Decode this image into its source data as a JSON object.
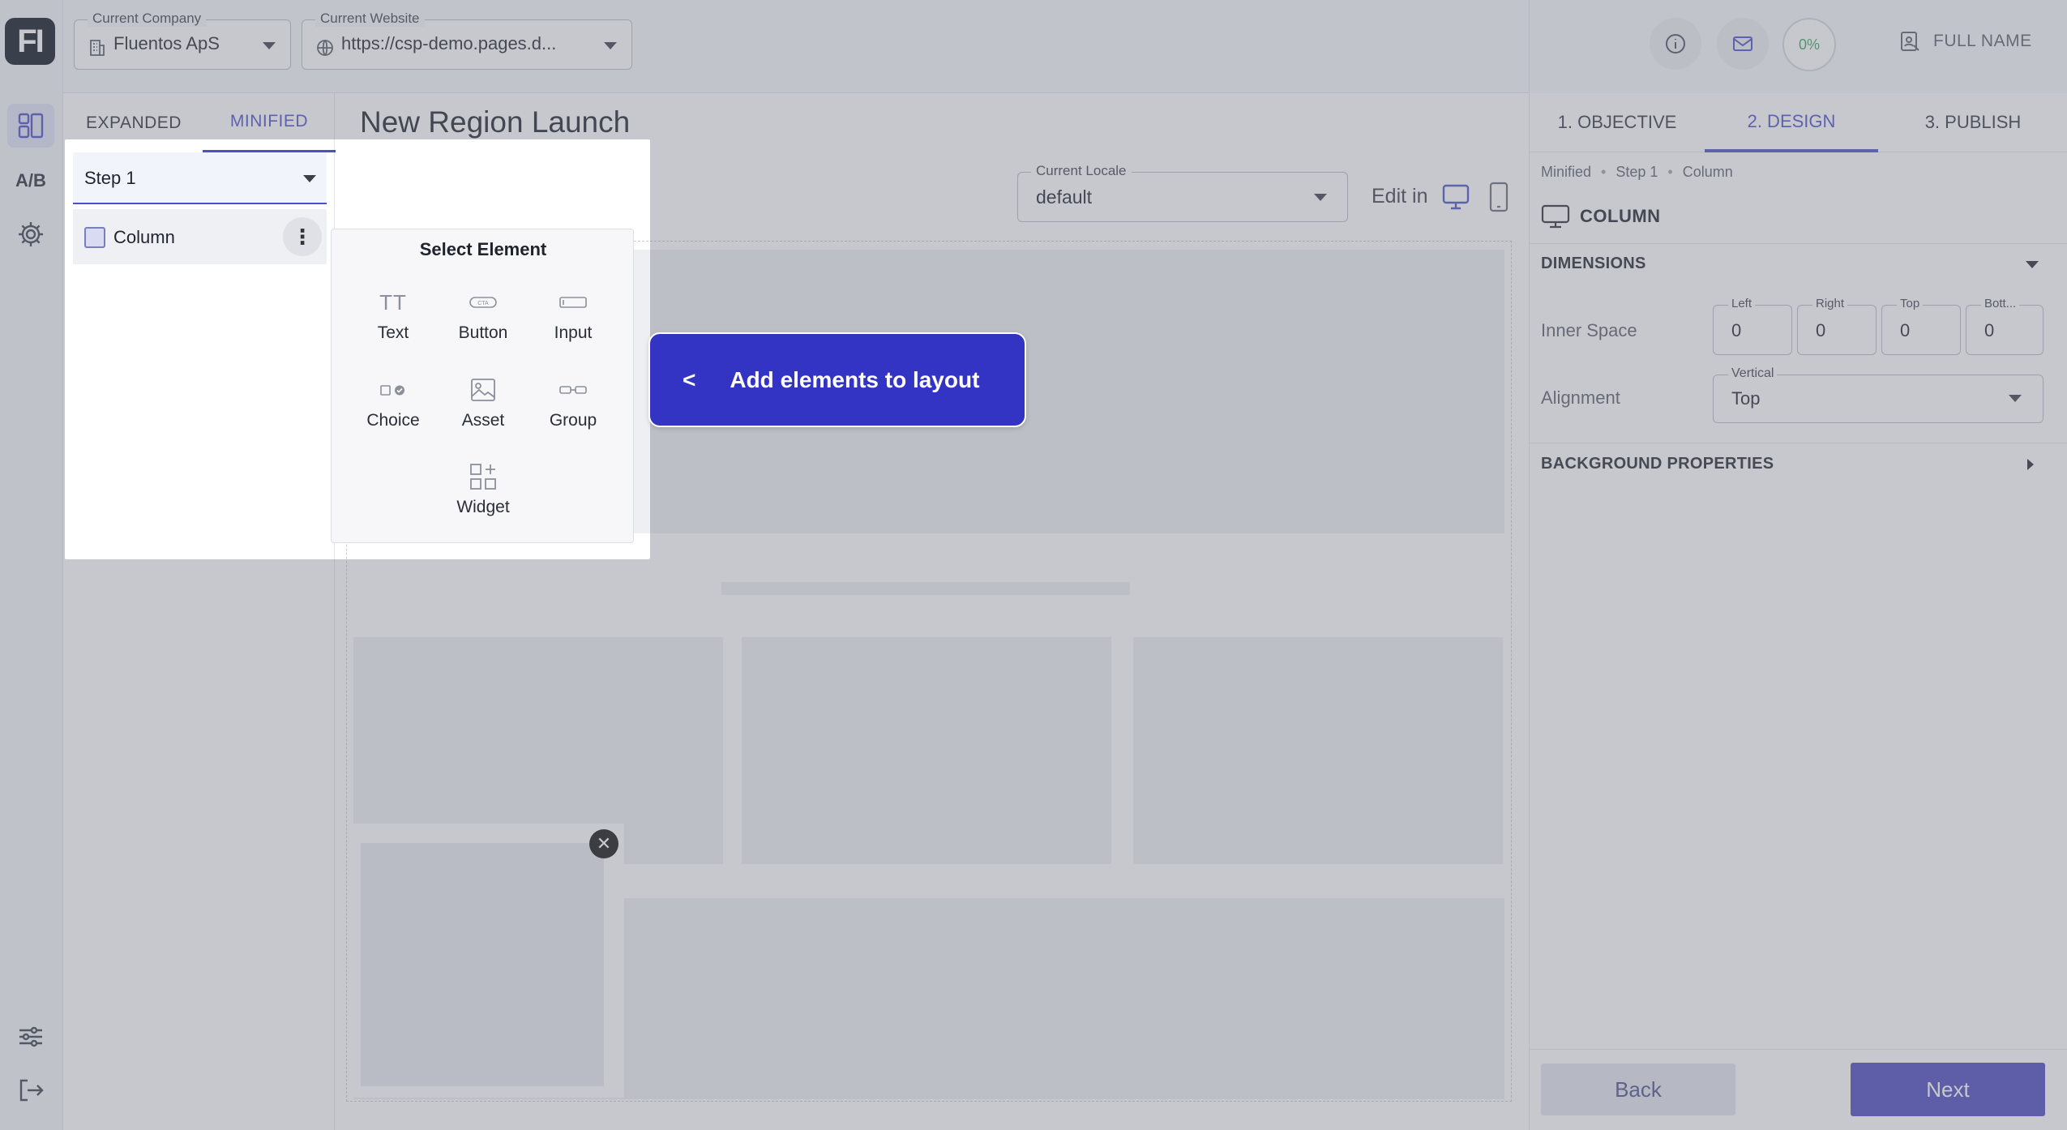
{
  "app": {
    "logo_text": "FI"
  },
  "rail": {
    "items": [
      {
        "icon": "layout-grid-icon",
        "active": true
      },
      {
        "label": "A/B",
        "icon": "ab-test-icon"
      },
      {
        "icon": "gear-icon"
      }
    ],
    "bottom_items": [
      {
        "icon": "sliders-icon"
      },
      {
        "icon": "logout-icon"
      }
    ]
  },
  "header": {
    "company": {
      "label": "Current Company",
      "value": "Fluentos ApS",
      "icon": "building-icon"
    },
    "website": {
      "label": "Current Website",
      "value": "https://csp-demo.pages.d...",
      "icon": "globe-icon"
    },
    "progress": "0%",
    "user_name": "FULL NAME",
    "icons": [
      "info-icon",
      "mail-icon",
      "user-badge-icon"
    ]
  },
  "layers_panel": {
    "tabs": [
      {
        "label": "EXPANDED",
        "active": false
      },
      {
        "label": "MINIFIED",
        "active": true
      }
    ],
    "step_select": "Step 1",
    "tree": [
      {
        "label": "Column"
      }
    ]
  },
  "main": {
    "title": "New Region Launch",
    "locale": {
      "label": "Current Locale",
      "value": "default"
    },
    "edit_in_label": "Edit in",
    "device_icons": [
      "desktop-icon",
      "mobile-icon"
    ]
  },
  "select_element": {
    "title": "Select Element",
    "options": [
      {
        "label": "Text",
        "icon": "text-icon"
      },
      {
        "label": "Button",
        "icon": "button-cta-icon",
        "icon_text": "CTA"
      },
      {
        "label": "Input",
        "icon": "input-icon"
      },
      {
        "label": "Choice",
        "icon": "choice-icon"
      },
      {
        "label": "Asset",
        "icon": "image-icon"
      },
      {
        "label": "Group",
        "icon": "group-icon"
      },
      {
        "label": "Widget",
        "icon": "widget-icon"
      }
    ]
  },
  "hint": {
    "arrow": "<",
    "text": "Add elements to layout"
  },
  "properties": {
    "steps": [
      {
        "label": "1. OBJECTIVE",
        "active": false
      },
      {
        "label": "2. DESIGN",
        "active": true
      },
      {
        "label": "3. PUBLISH",
        "active": false
      }
    ],
    "breadcrumb": [
      "Minified",
      "Step 1",
      "Column"
    ],
    "element_title": "COLUMN",
    "dimensions": {
      "header": "DIMENSIONS",
      "inner_space_label": "Inner Space",
      "fields": [
        {
          "label": "Left",
          "value": "0"
        },
        {
          "label": "Right",
          "value": "0"
        },
        {
          "label": "Top",
          "value": "0"
        },
        {
          "label": "Bott...",
          "value": "0"
        }
      ],
      "alignment_label": "Alignment",
      "vertical": {
        "label": "Vertical",
        "value": "Top"
      }
    },
    "background_header": "BACKGROUND PROPERTIES",
    "back_label": "Back",
    "next_label": "Next"
  },
  "colors": {
    "accent": "#4b50c8",
    "hint_bg": "#3434c4",
    "progress": "#3aa95b"
  }
}
